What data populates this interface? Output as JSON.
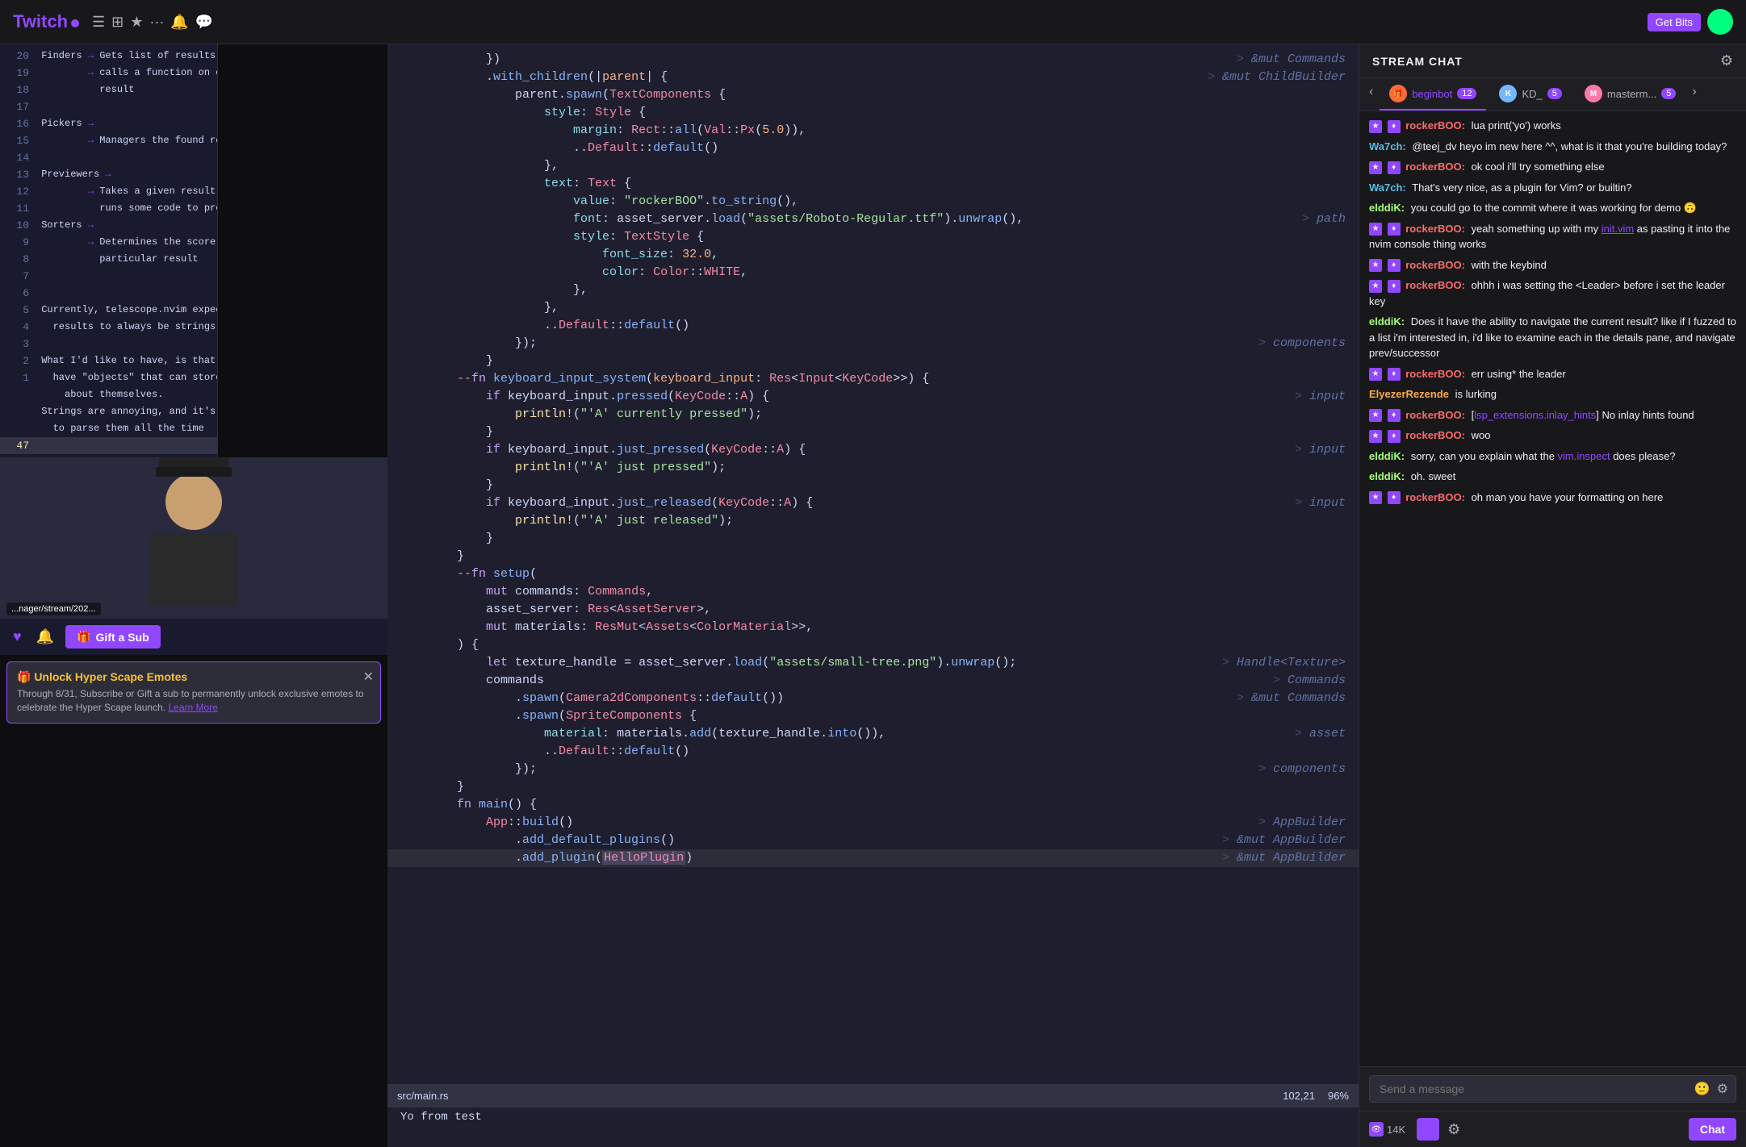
{
  "topbar": {
    "logo": "Twitch",
    "icons": [
      "≡≡",
      "···",
      "☆",
      "♡"
    ],
    "get_bits": "Get Bits"
  },
  "chat": {
    "header_title": "STREAM CHAT",
    "tabs": [
      {
        "label": "beginbot",
        "badge": "12",
        "type": "user"
      },
      {
        "label": "KD_",
        "badge": "5",
        "type": "user"
      },
      {
        "label": "masterm...",
        "badge": "5",
        "type": "user"
      }
    ],
    "messages": [
      {
        "user": "rockerBOO",
        "badges": [
          "purple",
          "purple"
        ],
        "text": "lua print('yo') works"
      },
      {
        "user": "Wa7ch",
        "badges": [],
        "text": "@teej_dv heyo im new here ^^, what is it that you're building today?"
      },
      {
        "user": "rockerBOO",
        "badges": [
          "purple",
          "purple"
        ],
        "text": "ok cool i'll try something else"
      },
      {
        "user": "Wa7ch",
        "badges": [],
        "text": "That's very nice, as a plugin for Vim? or builtin?"
      },
      {
        "user": "elddiK",
        "badges": [],
        "text": "you could go to the commit where it was working for demo 🙃"
      },
      {
        "user": "rockerBOO",
        "badges": [
          "purple",
          "purple"
        ],
        "text": "yeah something up with my"
      },
      {
        "user": "rockerBOO",
        "badges": [
          "purple",
          "purple"
        ],
        "text": "init.vim as pasting it into the nvim console thing works"
      },
      {
        "user": "rockerBOO",
        "badges": [
          "purple",
          "purple"
        ],
        "text": "with the keybind"
      },
      {
        "user": "rockerBOO",
        "badges": [
          "purple",
          "purple"
        ],
        "text": "ohhh i was setting the <Leader> before i set the leader key"
      },
      {
        "user": "elddiK",
        "badges": [],
        "text": "Does it have the ability to navigate the current result? like if I fuzzed to a list i'm interested in, i'd like to examine each in the details pane, and navigate prev/successor"
      },
      {
        "user": "rockerBOO",
        "badges": [
          "purple",
          "purple"
        ],
        "text": "err using* the leader"
      },
      {
        "user": "ElyezerRezende",
        "badges": [],
        "text": "is lurking"
      },
      {
        "user": "rockerBOO",
        "badges": [
          "purple",
          "purple"
        ],
        "text": "[lsp_extensions.inlay_hints] No inlay hints found"
      },
      {
        "user": "rockerBOO",
        "badges": [
          "purple",
          "purple"
        ],
        "text": "woo"
      },
      {
        "user": "elddiK",
        "badges": [],
        "text": "sorry, can you explain what the vim.inspect does please?"
      },
      {
        "user": "elddiK",
        "badges": [],
        "text": "oh. sweet"
      },
      {
        "user": "rockerBOO",
        "badges": [
          "purple",
          "purple"
        ],
        "text": "oh man you have your formatting on here"
      }
    ],
    "input_placeholder": "Send a message",
    "viewers": "14K",
    "chat_btn": "Chat",
    "gift_sub_btn": "Gift a Sub"
  },
  "code": {
    "filename": "src/main.rs",
    "position": "102,21",
    "zoom": "96%",
    "terminal_text": "Yo from test",
    "lines": [
      {
        "num": "",
        "content": "    })"
      },
      {
        "num": "",
        "content": "    .with_children(|parent| {",
        "comment": "&mut Commands"
      },
      {
        "num": "",
        "content": "        parent.spawn(TextComponents {",
        "comment": "&mut ChildBuilder"
      },
      {
        "num": "",
        "content": "            style: Style {"
      },
      {
        "num": "",
        "content": "                margin: Rect::all(Val::Px(5.0)),"
      },
      {
        "num": "",
        "content": "                ..Default::default()"
      },
      {
        "num": "",
        "content": "            },"
      },
      {
        "num": "",
        "content": "            text: Text {"
      },
      {
        "num": "",
        "content": "                value: \"rockerBOO\".to_string(),",
        "comment": ""
      },
      {
        "num": "",
        "content": "                font: asset_server.load(\"assets/Roboto-Regular.ttf\").unwrap(),",
        "comment": "path"
      },
      {
        "num": "",
        "content": "                style: TextStyle {"
      },
      {
        "num": "",
        "content": "                    font_size: 32.0,"
      },
      {
        "num": "",
        "content": "                    color: Color::WHITE,"
      },
      {
        "num": "",
        "content": "                },"
      },
      {
        "num": "",
        "content": "            },"
      },
      {
        "num": "",
        "content": "            ..Default::default()"
      },
      {
        "num": "",
        "content": "        });"
      },
      {
        "num": "",
        "content": "    }"
      },
      {
        "num": "",
        "content": ""
      },
      {
        "num": "",
        "content": "--fn keyboard_input_system(keyboard_input: Res<Input<KeyCode>>) {",
        "comment": ""
      },
      {
        "num": "",
        "content": "    if keyboard_input.pressed(KeyCode::A) {",
        "comment": "input"
      },
      {
        "num": "",
        "content": "        println!(\"'A' currently pressed\");"
      },
      {
        "num": "",
        "content": "    }"
      },
      {
        "num": "",
        "content": ""
      },
      {
        "num": "",
        "content": "    if keyboard_input.just_pressed(KeyCode::A) {",
        "comment": "input"
      },
      {
        "num": "",
        "content": "        println!(\"'A' just pressed\");"
      },
      {
        "num": "",
        "content": "    }"
      },
      {
        "num": "",
        "content": ""
      },
      {
        "num": "",
        "content": "    if keyboard_input.just_released(KeyCode::A) {",
        "comment": "input"
      },
      {
        "num": "",
        "content": "        println!(\"'A' just released\");"
      },
      {
        "num": "",
        "content": "    }"
      },
      {
        "num": "",
        "content": "}"
      },
      {
        "num": "",
        "content": ""
      },
      {
        "num": "",
        "content": "--fn setup(",
        "comment": ""
      },
      {
        "num": "",
        "content": "    mut commands: Commands,"
      },
      {
        "num": "",
        "content": "    asset_server: Res<AssetServer>,"
      },
      {
        "num": "",
        "content": "    mut materials: ResMut<Assets<ColorMaterial>>,"
      },
      {
        "num": "",
        "content": ") {"
      },
      {
        "num": "",
        "content": "    let texture_handle = asset_server.load(\"assets/small-tree.png\").unwrap();",
        "comment": "Handle<Texture>"
      },
      {
        "num": "",
        "content": ""
      },
      {
        "num": "",
        "content": "    commands",
        "comment": "Commands"
      },
      {
        "num": "",
        "content": "        .spawn(Camera2dComponents::default())",
        "comment": "&mut Commands"
      },
      {
        "num": "",
        "content": "        .spawn(SpriteComponents {"
      },
      {
        "num": "",
        "content": "            material: materials.add(texture_handle.into()),",
        "comment": "asset"
      },
      {
        "num": "",
        "content": "            ..Default::default()"
      },
      {
        "num": "",
        "content": "        });",
        "comment": "components"
      },
      {
        "num": "",
        "content": "}"
      },
      {
        "num": "",
        "content": ""
      },
      {
        "num": "",
        "content": "fn main() {"
      },
      {
        "num": "",
        "content": "    App::build()"
      },
      {
        "num": "",
        "content": "        .add_default_plugins()"
      },
      {
        "num": "",
        "content": "        .add_plugin(HelloPlugin)"
      }
    ]
  },
  "nvim": {
    "lines": [
      {
        "num": "20",
        "content": " Finders → Gets list of results"
      },
      {
        "num": "19",
        "content": "          → calls a function on each"
      },
      {
        "num": "18",
        "content": "            result"
      },
      {
        "num": "17",
        "content": ""
      },
      {
        "num": "16",
        "content": " Pickers →"
      },
      {
        "num": "15",
        "content": "          → Managers the found results"
      },
      {
        "num": "14",
        "content": ""
      },
      {
        "num": "13",
        "content": " Previewers →"
      },
      {
        "num": "12",
        "content": "          → Takes a given result, and"
      },
      {
        "num": "11",
        "content": "            runs some code to preview it"
      },
      {
        "num": "",
        "content": ""
      },
      {
        "num": "10",
        "content": " Sorters →"
      },
      {
        "num": "9",
        "content": "          → Determines the score for a"
      },
      {
        "num": "8",
        "content": "            particular result"
      },
      {
        "num": "7",
        "content": ""
      },
      {
        "num": "6",
        "content": ""
      },
      {
        "num": "5",
        "content": " Currently, telescope.nvim expects"
      },
      {
        "num": "4",
        "content": "   results to always be strings."
      },
      {
        "num": "3",
        "content": ""
      },
      {
        "num": "2",
        "content": " What I'd like to have, is that we can"
      },
      {
        "num": "1",
        "content": "   have \"objects\" that can store state"
      },
      {
        "num": "",
        "content": "     about themselves."
      },
      {
        "num": "",
        "content": ""
      },
      {
        "num": "",
        "content": " Strings are annoying, and it's annoying"
      },
      {
        "num": "",
        "content": "   to parse them all the time"
      },
      {
        "num": "47",
        "content": ""
      }
    ]
  },
  "emote_notification": {
    "title": "🎁 Unlock Hyper Scape Emotes",
    "text": "Through 8/31, Subscribe or Gift a sub to permanently unlock exclusive emotes to celebrate the Hyper Scape launch.",
    "learn_more": "Learn More"
  }
}
